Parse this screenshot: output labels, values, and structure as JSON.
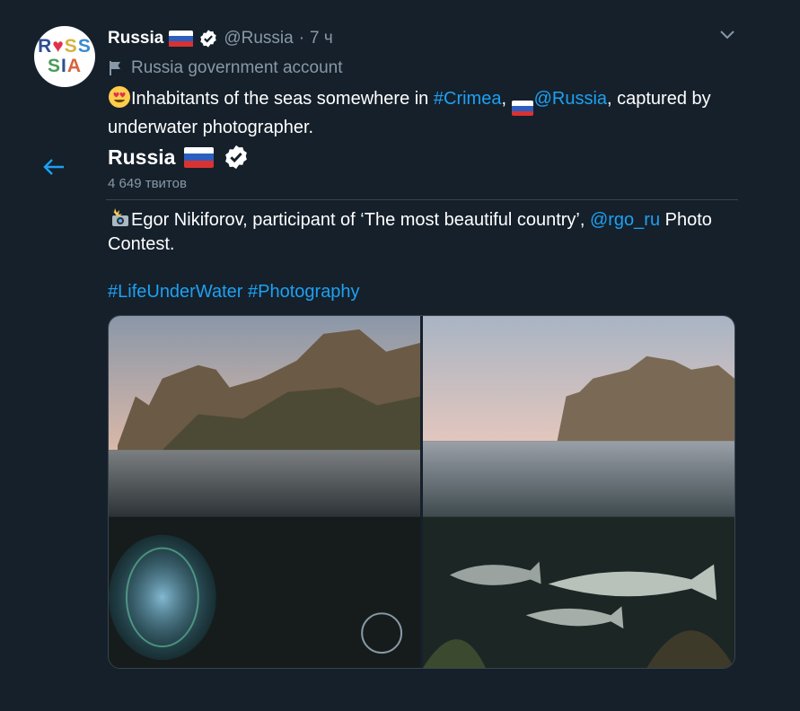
{
  "account": {
    "avatar_row1": [
      "R",
      "♥",
      "S",
      "S"
    ],
    "avatar_row2": [
      "S",
      "I",
      "A"
    ],
    "name": "Russia",
    "handle": "@Russia",
    "separator": "·",
    "time": "7 ч",
    "government_label": "Russia government account"
  },
  "tweet": {
    "text_part1": "Inhabitants of the seas somewhere in ",
    "hashtag_crimea": "#Crimea",
    "text_part2": ", ",
    "mention_russia": "@Russia",
    "text_part3": ", captured by underwater photographer."
  },
  "profile": {
    "name": "Russia",
    "tweet_count": "4 649 твитов"
  },
  "quoted": {
    "text_part1": "Egor Nikiforov, participant of ‘The most beautiful country’, ",
    "mention_rgo": "@rgo_ru",
    "text_part2": " Photo Contest.",
    "hashtag1": "#LifeUnderWater",
    "hashtag2": "#Photography"
  },
  "media": {
    "photos": [
      "jellyfish-photo",
      "fish-photo"
    ]
  },
  "colors": {
    "background": "#15202b",
    "link": "#1da1f2",
    "muted": "#8899a6",
    "verified_badge": "#ffffff"
  }
}
